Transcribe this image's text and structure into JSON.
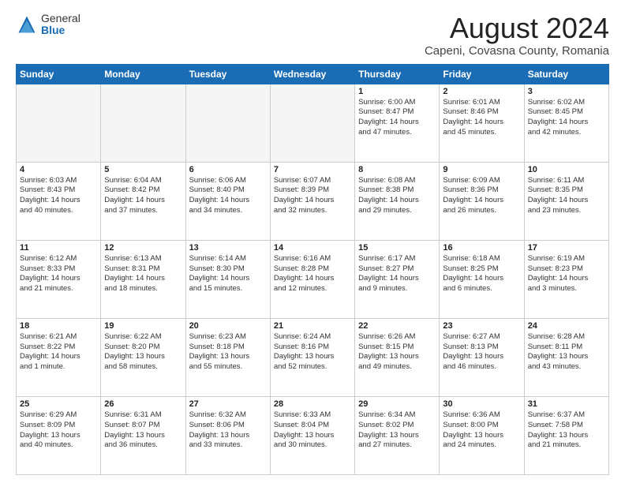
{
  "logo": {
    "general": "General",
    "blue": "Blue"
  },
  "header": {
    "month_year": "August 2024",
    "location": "Capeni, Covasna County, Romania"
  },
  "days_of_week": [
    "Sunday",
    "Monday",
    "Tuesday",
    "Wednesday",
    "Thursday",
    "Friday",
    "Saturday"
  ],
  "weeks": [
    [
      {
        "day": "",
        "info": ""
      },
      {
        "day": "",
        "info": ""
      },
      {
        "day": "",
        "info": ""
      },
      {
        "day": "",
        "info": ""
      },
      {
        "day": "1",
        "info": "Sunrise: 6:00 AM\nSunset: 8:47 PM\nDaylight: 14 hours\nand 47 minutes."
      },
      {
        "day": "2",
        "info": "Sunrise: 6:01 AM\nSunset: 8:46 PM\nDaylight: 14 hours\nand 45 minutes."
      },
      {
        "day": "3",
        "info": "Sunrise: 6:02 AM\nSunset: 8:45 PM\nDaylight: 14 hours\nand 42 minutes."
      }
    ],
    [
      {
        "day": "4",
        "info": "Sunrise: 6:03 AM\nSunset: 8:43 PM\nDaylight: 14 hours\nand 40 minutes."
      },
      {
        "day": "5",
        "info": "Sunrise: 6:04 AM\nSunset: 8:42 PM\nDaylight: 14 hours\nand 37 minutes."
      },
      {
        "day": "6",
        "info": "Sunrise: 6:06 AM\nSunset: 8:40 PM\nDaylight: 14 hours\nand 34 minutes."
      },
      {
        "day": "7",
        "info": "Sunrise: 6:07 AM\nSunset: 8:39 PM\nDaylight: 14 hours\nand 32 minutes."
      },
      {
        "day": "8",
        "info": "Sunrise: 6:08 AM\nSunset: 8:38 PM\nDaylight: 14 hours\nand 29 minutes."
      },
      {
        "day": "9",
        "info": "Sunrise: 6:09 AM\nSunset: 8:36 PM\nDaylight: 14 hours\nand 26 minutes."
      },
      {
        "day": "10",
        "info": "Sunrise: 6:11 AM\nSunset: 8:35 PM\nDaylight: 14 hours\nand 23 minutes."
      }
    ],
    [
      {
        "day": "11",
        "info": "Sunrise: 6:12 AM\nSunset: 8:33 PM\nDaylight: 14 hours\nand 21 minutes."
      },
      {
        "day": "12",
        "info": "Sunrise: 6:13 AM\nSunset: 8:31 PM\nDaylight: 14 hours\nand 18 minutes."
      },
      {
        "day": "13",
        "info": "Sunrise: 6:14 AM\nSunset: 8:30 PM\nDaylight: 14 hours\nand 15 minutes."
      },
      {
        "day": "14",
        "info": "Sunrise: 6:16 AM\nSunset: 8:28 PM\nDaylight: 14 hours\nand 12 minutes."
      },
      {
        "day": "15",
        "info": "Sunrise: 6:17 AM\nSunset: 8:27 PM\nDaylight: 14 hours\nand 9 minutes."
      },
      {
        "day": "16",
        "info": "Sunrise: 6:18 AM\nSunset: 8:25 PM\nDaylight: 14 hours\nand 6 minutes."
      },
      {
        "day": "17",
        "info": "Sunrise: 6:19 AM\nSunset: 8:23 PM\nDaylight: 14 hours\nand 3 minutes."
      }
    ],
    [
      {
        "day": "18",
        "info": "Sunrise: 6:21 AM\nSunset: 8:22 PM\nDaylight: 14 hours\nand 1 minute."
      },
      {
        "day": "19",
        "info": "Sunrise: 6:22 AM\nSunset: 8:20 PM\nDaylight: 13 hours\nand 58 minutes."
      },
      {
        "day": "20",
        "info": "Sunrise: 6:23 AM\nSunset: 8:18 PM\nDaylight: 13 hours\nand 55 minutes."
      },
      {
        "day": "21",
        "info": "Sunrise: 6:24 AM\nSunset: 8:16 PM\nDaylight: 13 hours\nand 52 minutes."
      },
      {
        "day": "22",
        "info": "Sunrise: 6:26 AM\nSunset: 8:15 PM\nDaylight: 13 hours\nand 49 minutes."
      },
      {
        "day": "23",
        "info": "Sunrise: 6:27 AM\nSunset: 8:13 PM\nDaylight: 13 hours\nand 46 minutes."
      },
      {
        "day": "24",
        "info": "Sunrise: 6:28 AM\nSunset: 8:11 PM\nDaylight: 13 hours\nand 43 minutes."
      }
    ],
    [
      {
        "day": "25",
        "info": "Sunrise: 6:29 AM\nSunset: 8:09 PM\nDaylight: 13 hours\nand 40 minutes."
      },
      {
        "day": "26",
        "info": "Sunrise: 6:31 AM\nSunset: 8:07 PM\nDaylight: 13 hours\nand 36 minutes."
      },
      {
        "day": "27",
        "info": "Sunrise: 6:32 AM\nSunset: 8:06 PM\nDaylight: 13 hours\nand 33 minutes."
      },
      {
        "day": "28",
        "info": "Sunrise: 6:33 AM\nSunset: 8:04 PM\nDaylight: 13 hours\nand 30 minutes."
      },
      {
        "day": "29",
        "info": "Sunrise: 6:34 AM\nSunset: 8:02 PM\nDaylight: 13 hours\nand 27 minutes."
      },
      {
        "day": "30",
        "info": "Sunrise: 6:36 AM\nSunset: 8:00 PM\nDaylight: 13 hours\nand 24 minutes."
      },
      {
        "day": "31",
        "info": "Sunrise: 6:37 AM\nSunset: 7:58 PM\nDaylight: 13 hours\nand 21 minutes."
      }
    ]
  ]
}
